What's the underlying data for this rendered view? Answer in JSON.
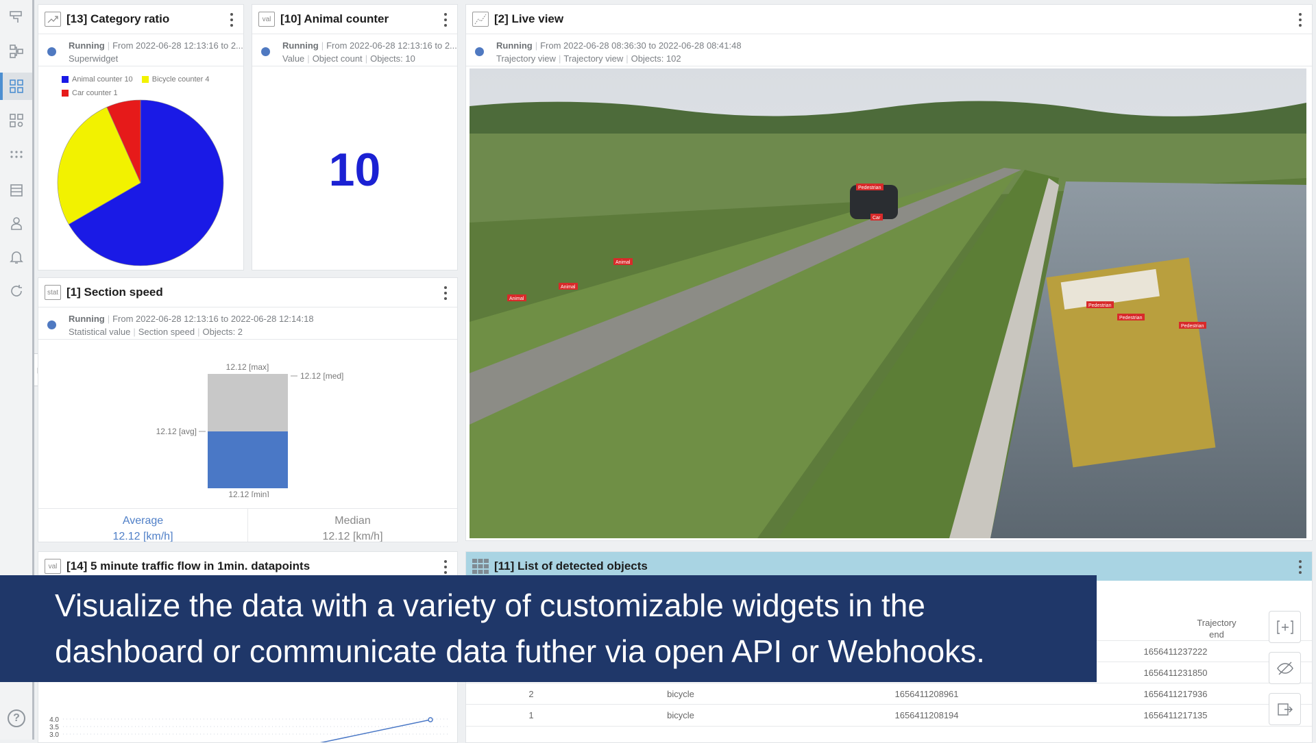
{
  "banner": {
    "line1": "Visualize the data with a variety of customizable widgets in the",
    "line2": "dashboard or communicate data futher via open API or Webhooks."
  },
  "sidebar": {
    "icons": [
      "routes-icon",
      "flow-icon",
      "dashboard-icon",
      "widget-settings-icon",
      "grid-dots-icon",
      "list-icon",
      "user-icon",
      "bell-icon",
      "refresh-icon"
    ],
    "help": "?"
  },
  "widgets": {
    "category_ratio": {
      "type_label": "",
      "title": "[13] Category ratio",
      "status": "Running",
      "range": "From 2022-06-28 12:13:16 to 2...",
      "subtitle": "Superwidget",
      "legend": [
        {
          "label": "Animal counter",
          "value": "10",
          "color": "#1a1ae6"
        },
        {
          "label": "Bicycle counter",
          "value": "4",
          "color": "#f2f200"
        },
        {
          "label": "Car counter",
          "value": "1",
          "color": "#e61a1a"
        }
      ]
    },
    "animal_counter": {
      "type_label": "val",
      "title": "[10] Animal counter",
      "status": "Running",
      "range": "From 2022-06-28 12:13:16 to 2...",
      "kind": "Value",
      "metric": "Object count",
      "objects": "Objects: 10",
      "value": "10"
    },
    "live_view": {
      "title": "[2] Live view",
      "status": "Running",
      "range": "From 2022-06-28 08:36:30 to 2022-06-28 08:41:48",
      "kind": "Trajectory view",
      "metric": "Trajectory view",
      "objects": "Objects: 102",
      "labels": {
        "pedestrian": "Pedestrian",
        "car": "Car",
        "animal": "Animal"
      }
    },
    "section_speed": {
      "type_label": "stat",
      "title": "[1] Section speed",
      "status": "Running",
      "range": "From 2022-06-28 12:13:16 to 2022-06-28 12:14:18",
      "kind": "Statistical value",
      "metric": "Section speed",
      "objects": "Objects: 2",
      "max_label": "12.12 [max]",
      "med_label": "12.12 [med]",
      "avg_label": "12.12 [avg]",
      "min_label": "12.12 [min]",
      "average_title": "Average",
      "average_value": "12.12 [km/h]",
      "median_title": "Median",
      "median_value": "12.12 [km/h]"
    },
    "traffic_flow": {
      "type_label": "val",
      "title": "[14] 5 minute traffic flow in 1min. datapoints",
      "ticks": [
        "4.0",
        "3.5",
        "3.0"
      ]
    },
    "detected_objects": {
      "title": "[11] List of detected objects",
      "col_end_line1": "Trajectory",
      "col_end_line2": "end",
      "rows": [
        {
          "id": "",
          "cls": "",
          "start": "",
          "end": "1656411237222"
        },
        {
          "id": "",
          "cls": "",
          "start": "",
          "end": "1656411231850"
        },
        {
          "id": "2",
          "cls": "bicycle",
          "start": "1656411208961",
          "end": "1656411217936"
        },
        {
          "id": "1",
          "cls": "bicycle",
          "start": "1656411208194",
          "end": "1656411217135"
        }
      ]
    }
  }
}
